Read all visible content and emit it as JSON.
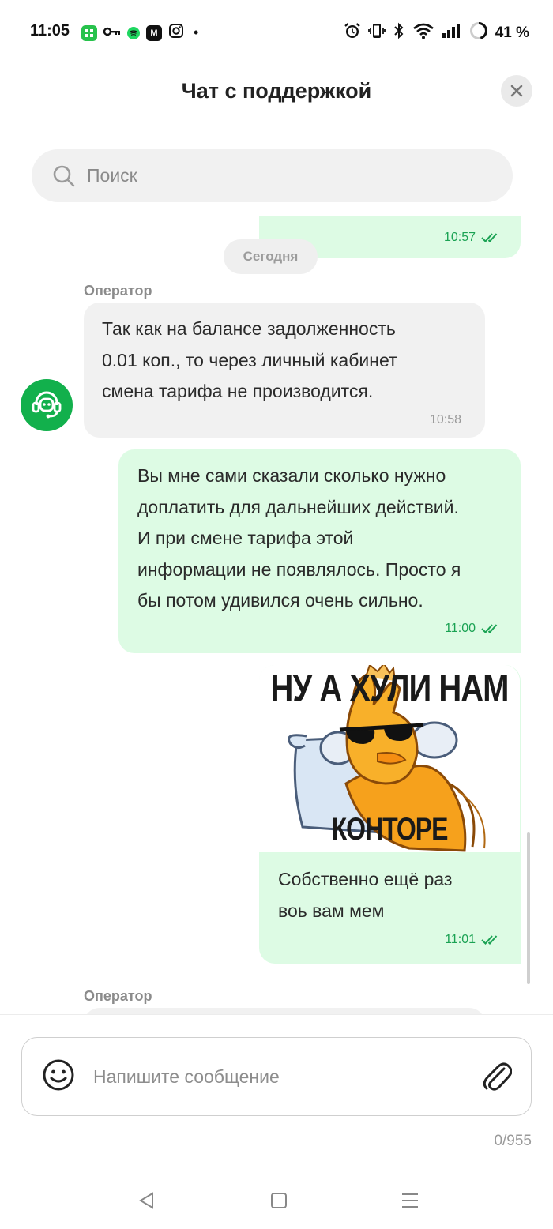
{
  "status_bar": {
    "time": "11:05",
    "battery": "41 %",
    "app_icons": [
      "shield-app-icon",
      "key-icon",
      "spotify-icon",
      "mtv-app-icon",
      "instagram-icon"
    ],
    "dot": "•"
  },
  "header": {
    "title": "Чат с поддержкой",
    "close_label": "×"
  },
  "search": {
    "placeholder": "Поиск"
  },
  "chat": {
    "date_separator": "Сегодня",
    "messages": [
      {
        "direction": "out",
        "time": "10:57",
        "read": true,
        "partial": true
      },
      {
        "direction": "in",
        "sender": "Оператор",
        "lines": [
          "Так как на балансе задолженность",
          "0.01 коп., то через личный кабинет",
          "смена тарифа не производится."
        ],
        "time": "10:58"
      },
      {
        "direction": "out",
        "lines": [
          "Вы мне сами сказали сколько нужно",
          "доплатить для дальнейших действий.",
          "И при смене тарифа этой",
          "информации не появлялось. Просто я",
          "бы потом удивился очень сильно."
        ],
        "time": "11:00",
        "read": true
      },
      {
        "direction": "out",
        "image": {
          "caption_top": "НУ А ХУЛИ НАМ",
          "caption_bottom": "КОНТОРЕ ПИДАРАСОВ"
        },
        "lines": [
          "Собственно ещё раз",
          "воь вам мем"
        ],
        "time": "11:01",
        "read": true
      },
      {
        "direction": "in",
        "sender": "Оператор",
        "partial": true
      }
    ]
  },
  "composer": {
    "placeholder": "Напишите сообщение",
    "counter": "0/955"
  },
  "colors": {
    "accent_green": "#12b04c",
    "outgoing_bubble": "#ddfbe4",
    "incoming_bubble": "#f1f1f1",
    "time_green": "#1aa253"
  }
}
